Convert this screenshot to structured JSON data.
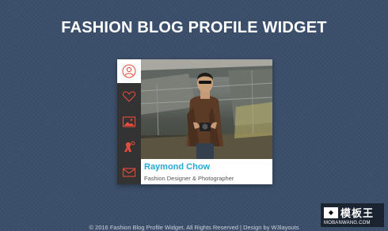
{
  "page": {
    "title": "FASHION BLOG PROFILE WIDGET"
  },
  "widget": {
    "accent_color": "#e84c3d",
    "name_color": "#26a9d4",
    "sidebar": [
      {
        "icon": "user-icon",
        "active": true
      },
      {
        "icon": "heart-icon",
        "active": false
      },
      {
        "icon": "image-icon",
        "active": false
      },
      {
        "icon": "social-icon",
        "active": false
      },
      {
        "icon": "mail-icon",
        "active": false
      }
    ],
    "photo": {
      "subject": "photographer-portrait"
    },
    "profile": {
      "name": "Raymond Chow",
      "role": "Fashion Designer & Photographer"
    }
  },
  "footer": {
    "text": "© 2016 Fashion Blog Profile Widget. All Rights Reserved | Design by W3layouts"
  },
  "watermark": {
    "brand": "模板王",
    "domain": "MOBANWANG.COM"
  }
}
